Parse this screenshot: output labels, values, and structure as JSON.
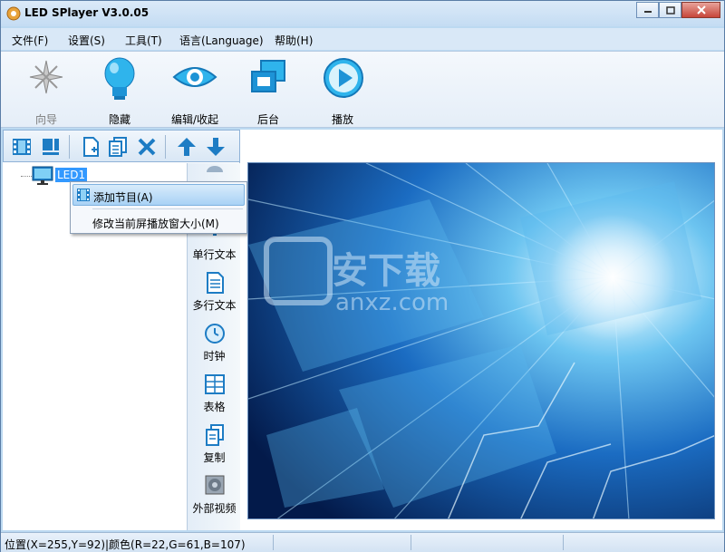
{
  "window": {
    "title": "LED SPlayer V3.0.05"
  },
  "menu": [
    {
      "label": "文件(F)"
    },
    {
      "label": "设置(S)"
    },
    {
      "label": "工具(T)"
    },
    {
      "label": "语言(Language)"
    },
    {
      "label": "帮助(H)"
    }
  ],
  "toolbar": [
    {
      "label": "向导",
      "icon": "wizard-icon",
      "enabled": false
    },
    {
      "label": "隐藏",
      "icon": "lightbulb-icon",
      "enabled": true
    },
    {
      "label": "编辑/收起",
      "icon": "eye-icon",
      "enabled": true
    },
    {
      "label": "后台",
      "icon": "windows-icon",
      "enabled": true
    },
    {
      "label": "播放",
      "icon": "play-icon",
      "enabled": true
    }
  ],
  "tree": {
    "node_label": "LED1"
  },
  "context_menu": {
    "item1": "添加节目(A)",
    "item2": "修改当前屏播放窗大小(M)"
  },
  "palette": [
    {
      "label": "单行文本",
      "icon": "single-line-text-icon"
    },
    {
      "label": "多行文本",
      "icon": "multi-line-text-icon"
    },
    {
      "label": "时钟",
      "icon": "clock-icon"
    },
    {
      "label": "表格",
      "icon": "table-icon"
    },
    {
      "label": "复制",
      "icon": "copy-icon"
    },
    {
      "label": "外部视频",
      "icon": "external-video-icon"
    }
  ],
  "watermark": {
    "brand": "安下载",
    "domain": "anxz.com"
  },
  "status": {
    "text": "位置(X=255,Y=92)|颜色(R=22,G=61,B=107)"
  },
  "colors": {
    "accent": "#3399ff",
    "window": "#bcd9f1",
    "preview_bg": "#0a3f8c"
  }
}
